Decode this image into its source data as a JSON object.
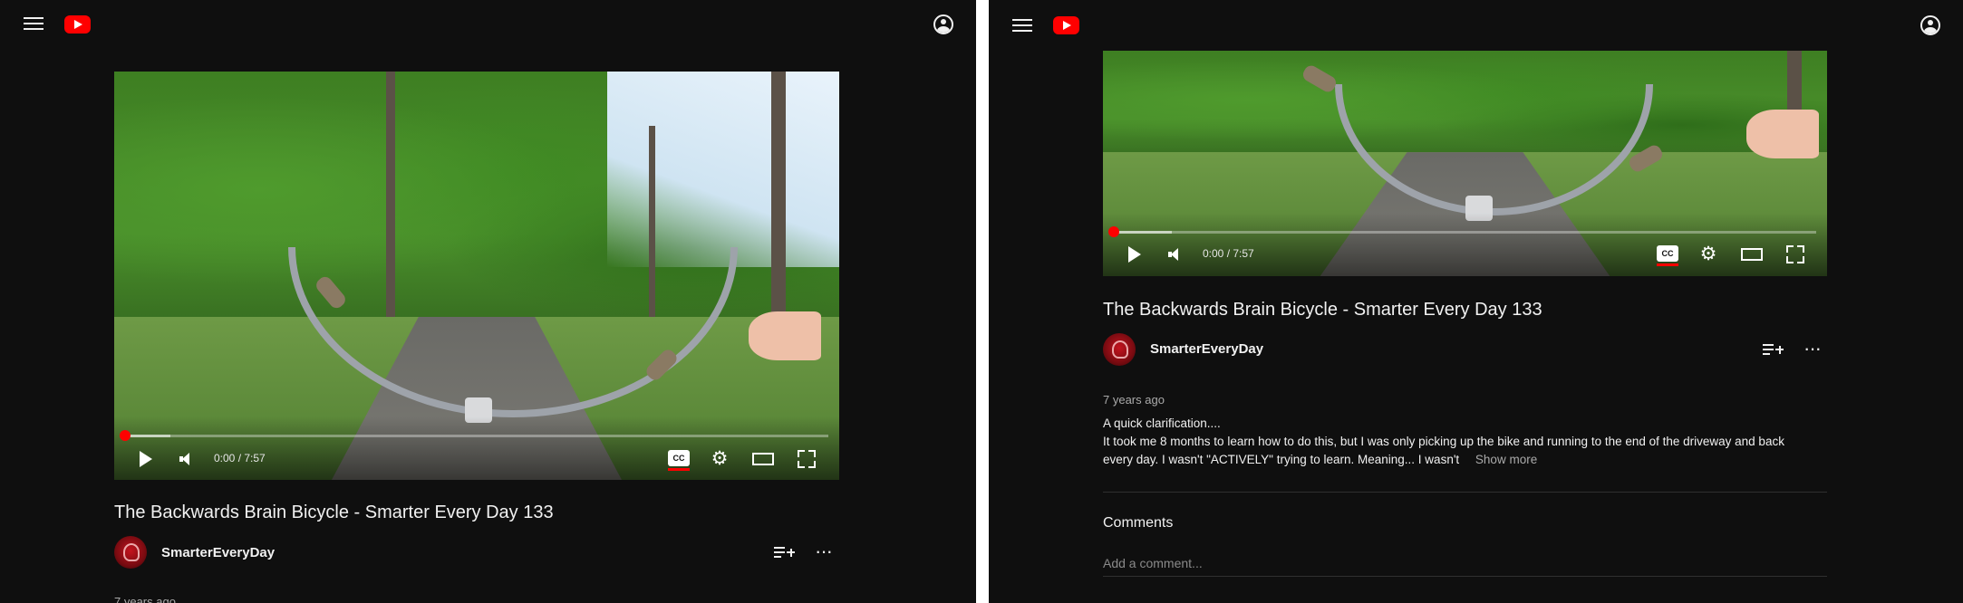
{
  "video": {
    "title": "The Backwards Brain Bicycle - Smarter Every Day 133",
    "channel": "SmarterEveryDay",
    "time_display": "0:00 / 7:57",
    "cc_label": "CC",
    "posted": "7 years ago",
    "description_lines": "A quick clarification....\nIt took me 8 months to learn how to do this, but I was only picking up the bike and running to the end of the driveway and back\nevery day.  I wasn't \"ACTIVELY\" trying to learn.  Meaning... I wasn't",
    "show_more": "Show more"
  },
  "comments": {
    "heading": "Comments",
    "placeholder": "Add a comment..."
  },
  "icons": {
    "menu": "hamburger-menu-icon",
    "logo": "youtube-logo-icon",
    "account": "account-icon",
    "play": "play-icon",
    "volume": "volume-icon",
    "captions": "closed-captions-icon",
    "settings": "gear-icon",
    "theater": "theater-mode-icon",
    "fullscreen": "fullscreen-icon",
    "save": "save-to-playlist-icon",
    "more": "more-actions-icon"
  },
  "colors": {
    "background": "#0f0f0f",
    "brand_red": "#ff0000",
    "text_primary": "#f1f1f1",
    "text_secondary": "#aaaaaa"
  }
}
